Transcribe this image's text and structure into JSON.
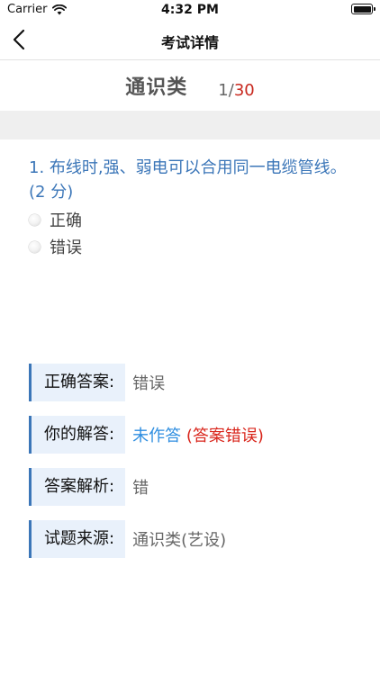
{
  "status_bar": {
    "carrier": "Carrier",
    "time": "4:32 PM"
  },
  "nav": {
    "title": "考试详情"
  },
  "exam": {
    "category": "通识类",
    "current": "1",
    "separator": "/",
    "total": "30"
  },
  "question": {
    "text": "1. 布线时,强、弱电可以合用同一电缆管线。(2 分)",
    "options": [
      {
        "label": "正确"
      },
      {
        "label": "错误"
      }
    ]
  },
  "info": {
    "correct_answer": {
      "label": "正确答案:",
      "value": "错误"
    },
    "your_answer": {
      "label": "你的解答:",
      "value": "未作答",
      "note": "(答案错误)"
    },
    "analysis": {
      "label": "答案解析:",
      "value": "错"
    },
    "source": {
      "label": "试题来源:",
      "value": "通识类(艺设)"
    }
  },
  "colors": {
    "accent_blue": "#3b76b8",
    "answer_blue": "#2f8ee0",
    "error_red": "#d9261c",
    "label_bg": "#e9f1fb"
  }
}
